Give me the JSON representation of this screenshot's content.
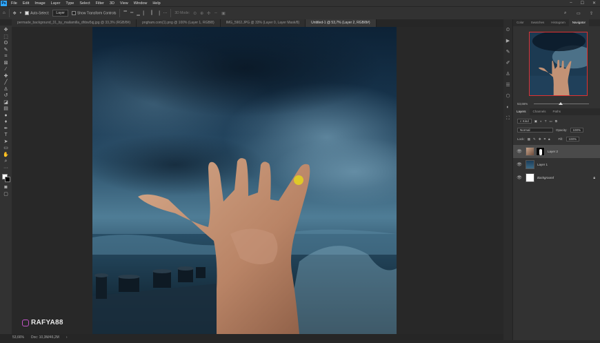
{
  "app": {
    "logo": "Ps"
  },
  "menu": [
    "File",
    "Edit",
    "Image",
    "Layer",
    "Type",
    "Select",
    "Filter",
    "3D",
    "View",
    "Window",
    "Help"
  ],
  "window_controls": {
    "minimize": "–",
    "maximize": "☐",
    "close": "✕"
  },
  "options": {
    "auto_select_label": "Auto-Select:",
    "auto_select_target": "Layer",
    "transform_label": "Show Transform Controls",
    "mode_3d": "3D Mode:"
  },
  "tabs": [
    "permade_background_31_by_mailamilla_dhbw5qj.jpg @ 33,3% (RGB/8#)",
    "pngham.com(1).png @ 100% (Layer 1, RGB/8)",
    "IMG_5902.JPG @ 33% (Layer 0, Layer Mask/8)",
    "Untitled-1 @ 53,7% (Layer 2, RGB/8#)"
  ],
  "active_tab": 3,
  "watermark": {
    "icon": "instagram-icon",
    "text": "RAFYA88"
  },
  "status": {
    "zoom": "53,66%",
    "doc": "Doc: 10,3M/46,2M"
  },
  "right_panel": {
    "tabs": [
      "Color",
      "Swatches",
      "Histogram",
      "Navigator"
    ],
    "active_tab": "Navigator",
    "zoom": "53,66%"
  },
  "layers_panel": {
    "tabs": [
      "Layers",
      "Channels",
      "Paths"
    ],
    "filter_kind": "Kind",
    "blend_mode": "Normal",
    "opacity_label": "Opacity:",
    "opacity_value": "100%",
    "lock_label": "Lock:",
    "fill_label": "Fill:",
    "fill_value": "100%",
    "layers": [
      {
        "name": "Layer 2",
        "selected": true
      },
      {
        "name": "Layer 1",
        "selected": false
      },
      {
        "name": "Background",
        "selected": false,
        "locked": true
      }
    ]
  },
  "colors": {
    "accent": "#31a8ff",
    "navigator_frame": "#e13131"
  }
}
